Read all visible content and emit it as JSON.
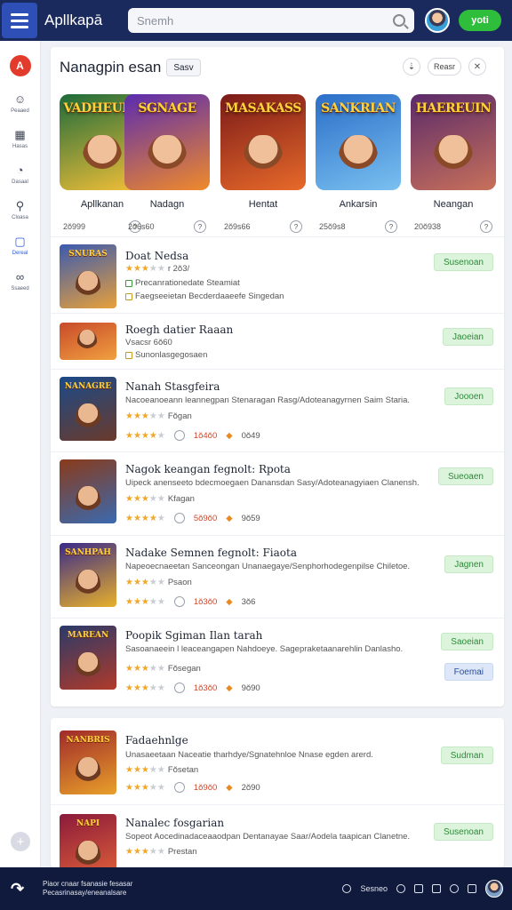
{
  "app": {
    "title": "Apllkapā"
  },
  "search": {
    "placeholder": "Snemh"
  },
  "header": {
    "action_label": "yoti"
  },
  "sidebar": {
    "logo": "A",
    "items": [
      {
        "label": "Peaaed",
        "icon": "user-icon"
      },
      {
        "label": "Hasas",
        "icon": "grid-icon"
      },
      {
        "label": "Dasaal",
        "icon": "dashboard-icon"
      },
      {
        "label": "Cloasa",
        "icon": "search-icon"
      },
      {
        "label": "Dereal",
        "icon": "folder-icon"
      },
      {
        "label": "Ssaeed",
        "icon": "network-icon"
      }
    ],
    "add_label": "+"
  },
  "section": {
    "title": "Nanagpin esan",
    "save_label": "Sasv",
    "pill_label": "Reasr",
    "icon_a": "⇣",
    "icon_b": "✕"
  },
  "featured": [
    {
      "art_title": "VADHEUER",
      "name": "Apllkanan",
      "count": "2ŏ999",
      "colors": [
        "#1d6b3a",
        "#f5c038"
      ]
    },
    {
      "art_title": "SGNAGE",
      "name": "Nadagn",
      "count": "2ŏ6s60",
      "colors": [
        "#5a2bb0",
        "#f08a2a"
      ]
    },
    {
      "art_title": "MASAKASS",
      "name": "Hentat",
      "count": "2ŏ9s66",
      "colors": [
        "#7a1a18",
        "#e86a2a"
      ]
    },
    {
      "art_title": "SANKRIAN",
      "name": "Ankarsin",
      "count": "25ŏ9s8",
      "colors": [
        "#2a6ec8",
        "#7ac0f0"
      ]
    },
    {
      "art_title": "HAEREUIN",
      "name": "Neangan",
      "count": "20ŏ938",
      "colors": [
        "#5a2a6a",
        "#c8705a"
      ]
    }
  ],
  "list": [
    {
      "title": "Doat Nedsa",
      "line2": "r 2ŏ3/",
      "sub1": "Precanrationedate Steamiat",
      "sub2": "Faegseeietan Becderdaaeefe Singedan",
      "button": "Susenoan",
      "art_title": "SNURAS",
      "colors": [
        "#3a5ab0",
        "#e8a03a"
      ],
      "stars": 3
    },
    {
      "title": "Roegh datier Raaan",
      "line2": "Vsacsr 6ŏ60",
      "sub1": "Sunonlasgegosaen",
      "button": "Jaoeian",
      "art_title": "",
      "colors": [
        "#c84a2a",
        "#f0a040"
      ],
      "stars": 0
    },
    {
      "title": "Nanah Stasgfeira",
      "desc": "Nacoeanoeann leannegpan Stenaragan Rasg/Adoteanagyrnen Saim Staria.",
      "line2": "Fŏgan",
      "button": "Joooen",
      "price": "1ŏ4ŏ0",
      "count": "0ŏ49",
      "art_title": "NANAGRE",
      "colors": [
        "#1a4a8a",
        "#6a3a2a"
      ],
      "stars": 3,
      "stars2": 4
    },
    {
      "title": "Nagok keangan fegnolt: Rpota",
      "desc": "Uipeck anenseeto bdecmoegaen Danansdan Sasy/Adoteanagyiaen Clanensh.",
      "line2": "Kfagan",
      "button": "Sueoaen",
      "price": "5ŏ9ŏ0",
      "count": "9ŏ59",
      "art_title": "",
      "colors": [
        "#8a3a1a",
        "#3a6ab0"
      ],
      "stars": 3,
      "stars2": 4
    },
    {
      "title": "Nadake Semnen fegnolt: Fiaota",
      "desc": "Napeoecnaeetan Sanceongan Unanaegaye/Senphorhodegenpilse Chiletoe.",
      "line2": "Psaon",
      "button": "Jagnen",
      "price": "1ŏ3ŏ0",
      "count": "3ŏ6",
      "art_title": "SANHPAH",
      "colors": [
        "#3a2a8a",
        "#e8b02a"
      ],
      "stars": 3,
      "stars2": 3
    },
    {
      "title": "Poopik Sgiman Ilan tarah",
      "desc": "Sasoanaeein l leaceangapen Nahdoeye. Sagepraketaanarehlin Danlasho.",
      "line2": "Fŏsegan",
      "button": "Saoeian",
      "button2": "Foemai",
      "price": "1ŏ3ŏ0",
      "count": "9ŏ90",
      "art_title": "MAREAN",
      "colors": [
        "#2a3a6a",
        "#b03a2a"
      ],
      "stars": 3,
      "stars2": 3
    }
  ],
  "list2": [
    {
      "title": "Fadaehnlge",
      "desc": "Unasaeetaan Naceatie tharhdye/Sgnatehnloe Nnase egden arerd.",
      "line2": "Fŏsetan",
      "button": "Sudman",
      "price": "1ŏ9ŏ0",
      "count": "2ŏ90",
      "art_title": "NANBRIS",
      "colors": [
        "#a02a2a",
        "#e8a02a"
      ],
      "stars": 3,
      "stars2": 3
    },
    {
      "title": "Nanalec fosgarian",
      "desc": "Sopeot Aocedinadaceaaodpan Dentanayae Saar/Aodela taapican Clanetne.",
      "line2": "Prestan",
      "button": "Susenoan",
      "price": "",
      "count": "",
      "art_title": "NAPI",
      "colors": [
        "#8a1a3a",
        "#e0603a"
      ],
      "stars": 3,
      "stars2": 0
    }
  ],
  "footer": {
    "line1": "Piaor cnaar fsanasie fesasar",
    "line2": "Pecasrinasay/eneanalsare",
    "right_label": "Sesneo"
  }
}
